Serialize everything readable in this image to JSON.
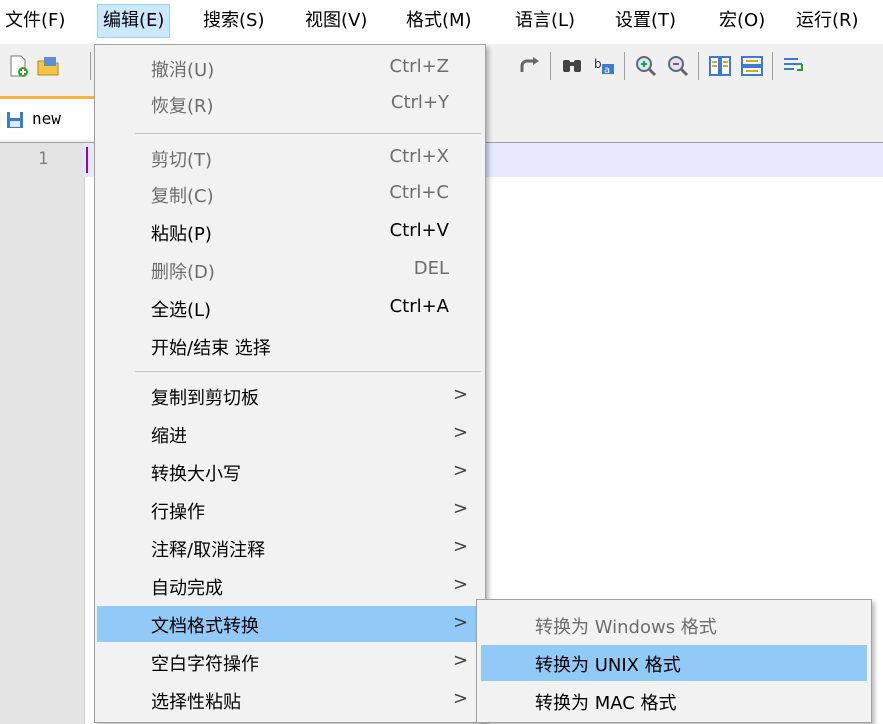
{
  "menubar": {
    "items": [
      {
        "label": "文件(F)"
      },
      {
        "label": "编辑(E)"
      },
      {
        "label": "搜索(S)"
      },
      {
        "label": "视图(V)"
      },
      {
        "label": "格式(M)"
      },
      {
        "label": "语言(L)"
      },
      {
        "label": "设置(T)"
      },
      {
        "label": "宏(O)"
      },
      {
        "label": "运行(R)"
      }
    ]
  },
  "tab": {
    "label": "new",
    "icon": "save-icon"
  },
  "editor": {
    "line_number": "1"
  },
  "edit_menu": {
    "items": [
      {
        "label": "撤消(U)",
        "shortcut": "Ctrl+Z"
      },
      {
        "label": "恢复(R)",
        "shortcut": "Ctrl+Y"
      },
      {
        "label": "剪切(T)",
        "shortcut": "Ctrl+X"
      },
      {
        "label": "复制(C)",
        "shortcut": "Ctrl+C"
      },
      {
        "label": "粘贴(P)",
        "shortcut": "Ctrl+V"
      },
      {
        "label": "删除(D)",
        "shortcut": "DEL"
      },
      {
        "label": "全选(L)",
        "shortcut": "Ctrl+A"
      },
      {
        "label": "开始/结束 选择"
      },
      {
        "label": "复制到剪切板",
        "arrow": ">"
      },
      {
        "label": "缩进",
        "arrow": ">"
      },
      {
        "label": "转换大小写",
        "arrow": ">"
      },
      {
        "label": "行操作",
        "arrow": ">"
      },
      {
        "label": "注释/取消注释",
        "arrow": ">"
      },
      {
        "label": "自动完成",
        "arrow": ">"
      },
      {
        "label": "文档格式转换",
        "arrow": ">"
      },
      {
        "label": "空白字符操作",
        "arrow": ">"
      },
      {
        "label": "选择性粘贴",
        "arrow": ">"
      }
    ]
  },
  "eol_submenu": {
    "items": [
      {
        "label": "转换为 Windows 格式"
      },
      {
        "label": "转换为 UNIX 格式"
      },
      {
        "label": "转换为 MAC 格式"
      }
    ]
  },
  "colors": {
    "highlight": "#91c9f7",
    "menu_open": "#cce8ff",
    "tab_accent": "#f7b33f",
    "disabled_text": "#6d6d6d"
  }
}
